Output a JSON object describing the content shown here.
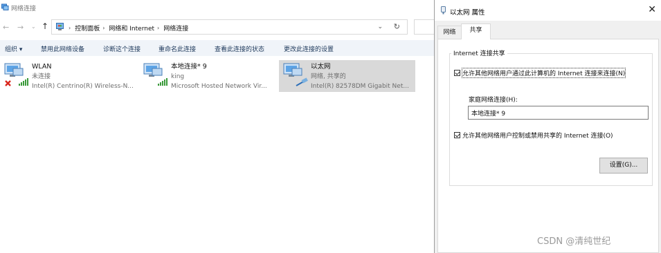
{
  "explorer": {
    "window_title": "网络连接",
    "nav": {
      "back": "←",
      "forward": "→",
      "recent": "⌄",
      "up": "↑"
    },
    "breadcrumbs": [
      "控制面板",
      "网络和 Internet",
      "网络连接"
    ],
    "address_dropdown": "⌄",
    "refresh": "↻",
    "toolbar": {
      "organize": "组织 ▾",
      "disable": "禁用此网络设备",
      "diagnose": "诊断这个连接",
      "rename": "重命名此连接",
      "status": "查看此连接的状态",
      "settings": "更改此连接的设置"
    },
    "connections": [
      {
        "name": "WLAN",
        "status": "未连接",
        "device": "Intel(R) Centrino(R) Wireless-N...",
        "icon": "wifi-disconnected-icon"
      },
      {
        "name": "本地连接* 9",
        "status": "king",
        "device": "Microsoft Hosted Network Vir...",
        "icon": "wifi-network-icon"
      },
      {
        "name": "以太网",
        "status": "网络, 共享的",
        "device": "Intel(R) 82578DM Gigabit Net...",
        "icon": "ethernet-network-icon",
        "selected": true
      }
    ]
  },
  "dialog": {
    "title": "以太网 属性",
    "close": "✕",
    "tabs": [
      "网络",
      "共享"
    ],
    "active_tab": "共享",
    "group_title": "Internet 连接共享",
    "allow_share": {
      "label": "允许其他网络用户通过此计算机的 Internet 连接来连接(N)",
      "checked": true
    },
    "home_network_label": "家庭网络连接(H):",
    "home_network_value": "本地连接* 9",
    "allow_control": {
      "label": "允许其他网络用户控制或禁用共享的 Internet 连接(O)",
      "checked": true
    },
    "settings_button": "设置(G)..."
  },
  "watermark": "CSDN @清纯世纪",
  "colors": {
    "command_bar": "#f0f4f9",
    "command_text": "#1e395b",
    "selected_item": "#d9d9d9",
    "dialog_bg": "#f0f0f0"
  }
}
